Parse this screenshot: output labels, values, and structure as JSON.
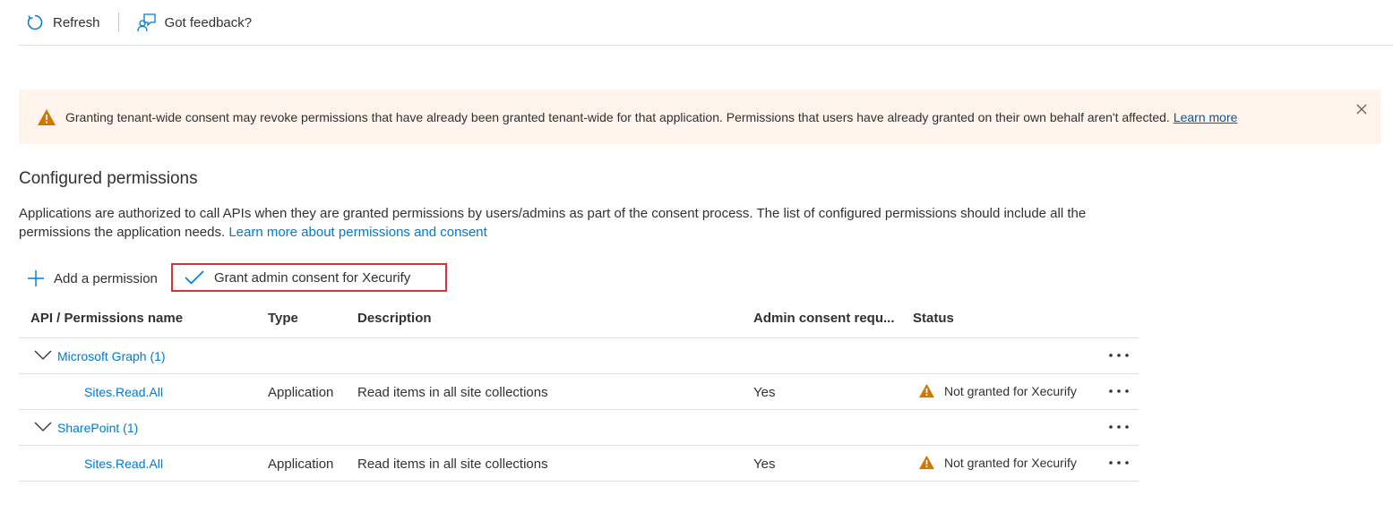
{
  "toolbar": {
    "refresh_label": "Refresh",
    "feedback_label": "Got feedback?"
  },
  "banner": {
    "text": "Granting tenant-wide consent may revoke permissions that have already been granted tenant-wide for that application. Permissions that users have already granted on their own behalf aren't affected.",
    "link": "Learn more",
    "background": "#fff4ec",
    "icon": "warning-icon"
  },
  "section": {
    "title": "Configured permissions",
    "description": "Applications are authorized to call APIs when they are granted permissions by users/admins as part of the consent process. The list of configured permissions should include all the permissions the application needs.",
    "description_link": "Learn more about permissions and consent"
  },
  "commands": {
    "add_label": "Add a permission",
    "grant_label": "Grant admin consent for Xecurify",
    "highlight_color": "#d13438"
  },
  "table": {
    "columns": [
      "API / Permissions name",
      "Type",
      "Description",
      "Admin consent requ...",
      "Status"
    ],
    "groups": [
      {
        "name": "Microsoft Graph (1)",
        "permissions": [
          {
            "name": "Sites.Read.All",
            "type": "Application",
            "description": "Read items in all site collections",
            "admin_consent": "Yes",
            "status": "Not granted for Xecurify"
          }
        ]
      },
      {
        "name": "SharePoint (1)",
        "permissions": [
          {
            "name": "Sites.Read.All",
            "type": "Application",
            "description": "Read items in all site collections",
            "admin_consent": "Yes",
            "status": "Not granted for Xecurify"
          }
        ]
      }
    ]
  },
  "colors": {
    "link": "#0078d4",
    "warning": "#d47500",
    "text": "#323130",
    "divider": "#e1dfdd"
  }
}
